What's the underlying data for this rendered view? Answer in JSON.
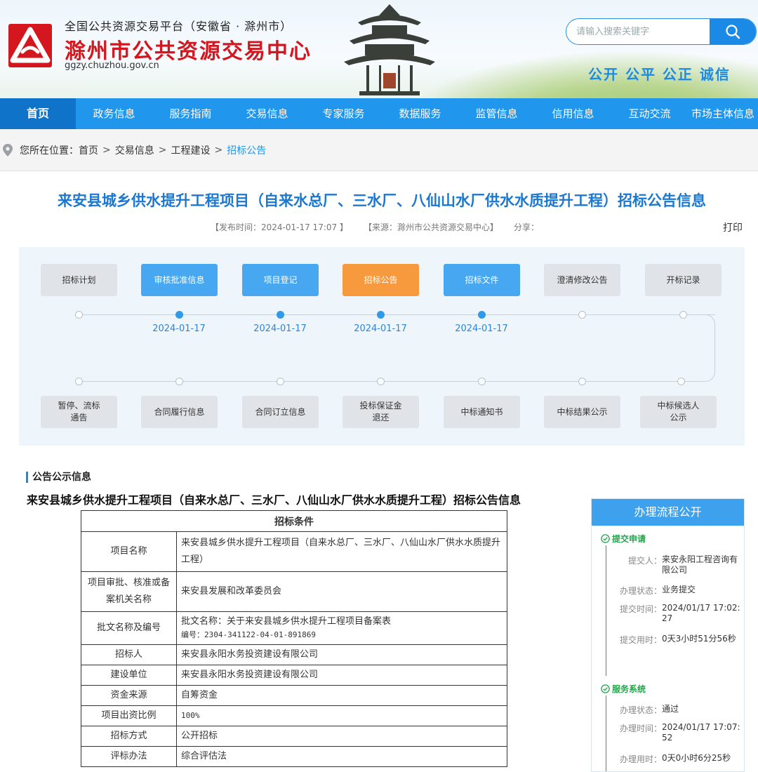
{
  "header": {
    "platform_line": "全国公共资源交易平台（安徽省 · 滁州市）",
    "site_title": "滁州市公共资源交易中心",
    "site_url": "ggzy.chuzhou.gov.cn",
    "search_placeholder": "请输入搜索关键字",
    "slogan": "公开 公平 公正 诚信",
    "brand_color": "#d4171e",
    "accent_color": "#2096ec"
  },
  "nav": {
    "items": [
      {
        "label": "首页",
        "active": true
      },
      {
        "label": "政务信息"
      },
      {
        "label": "服务指南"
      },
      {
        "label": "交易信息"
      },
      {
        "label": "专家服务"
      },
      {
        "label": "数据服务"
      },
      {
        "label": "监管信息"
      },
      {
        "label": "信用信息"
      },
      {
        "label": "互动交流"
      },
      {
        "label": "市场主体信息"
      }
    ]
  },
  "breadcrumb": {
    "prefix": "您所在位置：",
    "items": [
      "首页",
      "交易信息",
      "工程建设",
      "招标公告"
    ],
    "separator": ">"
  },
  "article": {
    "title": "来安县城乡供水提升工程项目（自来水总厂、三水厂、八仙山水厂供水水质提升工程）招标公告信息",
    "publish_time": "【发布时间：2024-01-17 17:07 】",
    "source": "【来源：滁州市公共资源交易中心】",
    "share": "分享：",
    "print": "打印"
  },
  "process": {
    "top": [
      {
        "label": "招标计划",
        "state": "grey",
        "date": ""
      },
      {
        "label": "审核批准信息",
        "state": "blue",
        "date": "2024-01-17"
      },
      {
        "label": "项目登记",
        "state": "blue",
        "date": "2024-01-17"
      },
      {
        "label": "招标公告",
        "state": "orange",
        "date": "2024-01-17"
      },
      {
        "label": "招标文件",
        "state": "blue",
        "date": "2024-01-17"
      },
      {
        "label": "澄清修改公告",
        "state": "grey",
        "date": ""
      },
      {
        "label": "开标记录",
        "state": "grey",
        "date": ""
      }
    ],
    "bottom": [
      {
        "label": "暂停、流标\n通告",
        "state": "grey"
      },
      {
        "label": "合同履行信息",
        "state": "grey"
      },
      {
        "label": "合同订立信息",
        "state": "grey"
      },
      {
        "label": "投标保证金\n退还",
        "state": "grey"
      },
      {
        "label": "中标通知书",
        "state": "grey"
      },
      {
        "label": "中标结果公示",
        "state": "grey"
      },
      {
        "label": "中标候选人\n公示",
        "state": "grey"
      }
    ]
  },
  "notice": {
    "section_label": "公告公示信息",
    "title": "来安县城乡供水提升工程项目（自来水总厂、三水厂、八仙山水厂供水水质提升工程）招标公告信息",
    "table_caption": "招标条件",
    "rows": [
      {
        "k": "项目名称",
        "v": "来安县城乡供水提升工程项目（自来水总厂、三水厂、八仙山水厂供水水质提升工程）"
      },
      {
        "k": "项目审批、核准或备案机关名称",
        "v": "来安县发展和改革委员会"
      },
      {
        "k": "批文名称及编号",
        "v": "批文名称：关于来安县城乡供水提升工程项目备案表",
        "v2": "编号：2304-341122-04-01-891869"
      },
      {
        "k": "招标人",
        "v": "来安县永阳水务投资建设有限公司"
      },
      {
        "k": "建设单位",
        "v": "来安县永阳水务投资建设有限公司"
      },
      {
        "k": "资金来源",
        "v": "自筹资金"
      },
      {
        "k": "项目出资比例",
        "v": "100%"
      },
      {
        "k": "招标方式",
        "v": "公开招标"
      },
      {
        "k": "评标办法",
        "v": "综合评估法"
      }
    ]
  },
  "side": {
    "title": "办理流程公开",
    "step1": {
      "title": "提交申请",
      "submitter_k": "提交人：",
      "submitter_v": "来安永阳工程咨询有限公司",
      "state_k": "办理状态：",
      "state_v": "业务提交",
      "time_k": "提交时间：",
      "time_v": "2024/01/17 17:02:27",
      "used_k": "提交用时：",
      "used_v": "0天3小时51分56秒"
    },
    "step2": {
      "title": "服务系统",
      "state_k": "办理状态：",
      "state_v": "通过",
      "time_k": "办理时间：",
      "time_v": "2024/01/17 17:07:52",
      "used_k": "办理用时：",
      "used_v": "0天0小时6分25秒"
    }
  }
}
